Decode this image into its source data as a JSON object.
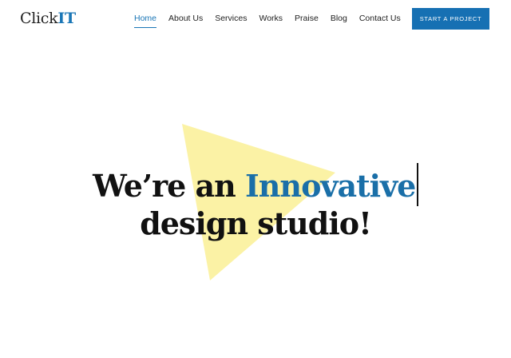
{
  "logo": {
    "part1": "Click",
    "part2": "IT"
  },
  "nav": {
    "items": [
      {
        "label": "Home",
        "active": true
      },
      {
        "label": "About Us"
      },
      {
        "label": "Services"
      },
      {
        "label": "Works"
      },
      {
        "label": "Praise"
      },
      {
        "label": "Blog"
      },
      {
        "label": "Contact Us"
      }
    ]
  },
  "cta": {
    "label": "START A PROJECT"
  },
  "hero": {
    "line1_prefix": "We’re an ",
    "line1_accent": "Innovative",
    "line2": "design studio!"
  },
  "colors": {
    "accent": "#1a76b6",
    "button": "#1670b3",
    "triangle": "#fbf2a5",
    "text": "#111111"
  }
}
